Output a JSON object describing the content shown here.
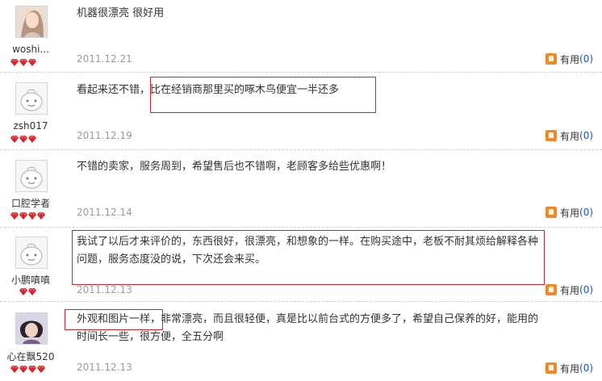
{
  "reviews": [
    {
      "user": "woshi...",
      "avatar": "photo",
      "gems": 3,
      "text": "机器很漂亮 很好用",
      "date": "2011.12.21",
      "useful_label": "有用",
      "useful_count": "(0)"
    },
    {
      "user": "zsh017",
      "avatar": "default",
      "gems": 3,
      "text": "看起来还不错，比在经销商那里买的啄木鸟便宜一半还多",
      "date": "2011.12.19",
      "useful_label": "有用",
      "useful_count": "(0)"
    },
    {
      "user": "口腔学者",
      "avatar": "default",
      "gems": 4,
      "text": "不错的卖家，服务周到，希望售后也不错啊，老顾客多给些优惠啊！",
      "date": "2011.12.14",
      "useful_label": "有用",
      "useful_count": "(0)"
    },
    {
      "user": "小鹏嗔嗔",
      "avatar": "default",
      "gems": 2,
      "text": "我试了以后才来评价的，东西很好，很漂亮，和想象的一样。在购买途中，老板不耐其烦给解释各种问题，服务态度没的说，下次还会来买。",
      "date": "2011.12.13",
      "useful_label": "有用",
      "useful_count": "(0)"
    },
    {
      "user": "心在飘520",
      "avatar": "photo2",
      "gems": 4,
      "text": "外观和图片一样，非常漂亮，而且很轻便，真是比以前台式的方便多了，希望自己保养的好，能用的时间长一些，很方便，全五分啊",
      "date": "2011.12.13",
      "useful_label": "有用",
      "useful_count": "(0)"
    }
  ],
  "colors": {
    "highlight": "#d0232a",
    "gem": "#d8232a",
    "useful_count": "#1a56b0",
    "date": "#9a9a9a"
  }
}
